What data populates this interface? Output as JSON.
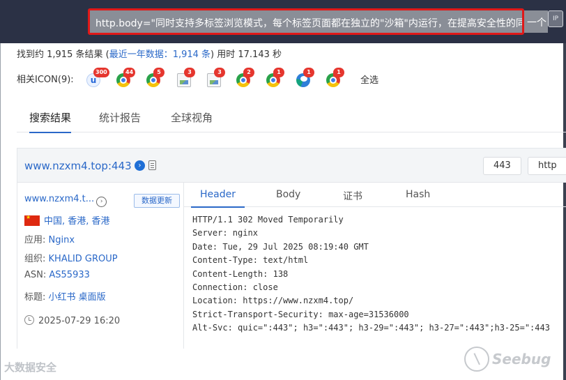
{
  "search": {
    "query": "http.body=\"同时支持多标签浏览模式，每个标签页面都在独立的\"沙箱\"内运行，在提高安全性的同时，",
    "overflow": "一个",
    "ip_button": "IP"
  },
  "stats": {
    "prefix": "找到约 1,915 条结果 (",
    "recent": "最近一年数据：1,914 条",
    "suffix": ") 用时 17.143 秒"
  },
  "icons": {
    "label": "相关ICON(9):",
    "items": [
      {
        "icon": "uc-browser-icon",
        "count": "300"
      },
      {
        "icon": "chrome-icon",
        "count": "44"
      },
      {
        "icon": "chrome-icon",
        "count": "5"
      },
      {
        "icon": "broken-image-icon",
        "count": "3"
      },
      {
        "icon": "broken-image-icon",
        "count": "3"
      },
      {
        "icon": "chrome-icon",
        "count": "2"
      },
      {
        "icon": "chrome-icon",
        "count": "1"
      },
      {
        "icon": "edge-icon",
        "count": "1"
      },
      {
        "icon": "chrome-icon",
        "count": "1"
      }
    ],
    "select_all": "全选"
  },
  "tabs": [
    {
      "label": "搜索结果",
      "active": true
    },
    {
      "label": "统计报告",
      "active": false
    },
    {
      "label": "全球视角",
      "active": false
    }
  ],
  "result": {
    "title": "www.nzxm4.top:443",
    "port": "443",
    "protocol": "http",
    "host_short": "www.nzxm4.t...",
    "update_button": "数据更新",
    "location": "中国, 香港, 香港",
    "app_label": "应用: ",
    "app_value": "Nginx",
    "org_label": "组织: ",
    "org_value": "KHALID GROUP",
    "asn_label": "ASN: ",
    "asn_value": "AS55933",
    "title_label": "标题: ",
    "title_value": "小红书 桌面版",
    "time": "2025-07-29 16:20",
    "detail_tabs": [
      {
        "label": "Header",
        "active": true
      },
      {
        "label": "Body",
        "active": false
      },
      {
        "label": "证书",
        "active": false
      },
      {
        "label": "Hash",
        "active": false
      }
    ],
    "header_lines": [
      "HTTP/1.1 302 Moved Temporarily",
      "Server: nginx",
      "Date: Tue, 29 Jul 2025 08:19:40 GMT",
      "Content-Type: text/html",
      "Content-Length: 138",
      "Connection: close",
      "Location: https://www.nzxm4.top/",
      "Strict-Transport-Security: max-age=31536000",
      "Alt-Svc: quic=\":443\"; h3=\":443\"; h3-29=\":443\"; h3-27=\":443\";h3-25=\":443"
    ]
  },
  "watermarks": {
    "left": "大数据安全",
    "right": "Seebug"
  },
  "colors": {
    "topbar": "#2b3145",
    "accent": "#2a68c8",
    "highlight_border": "#e01818",
    "badge": "#e5362e"
  }
}
